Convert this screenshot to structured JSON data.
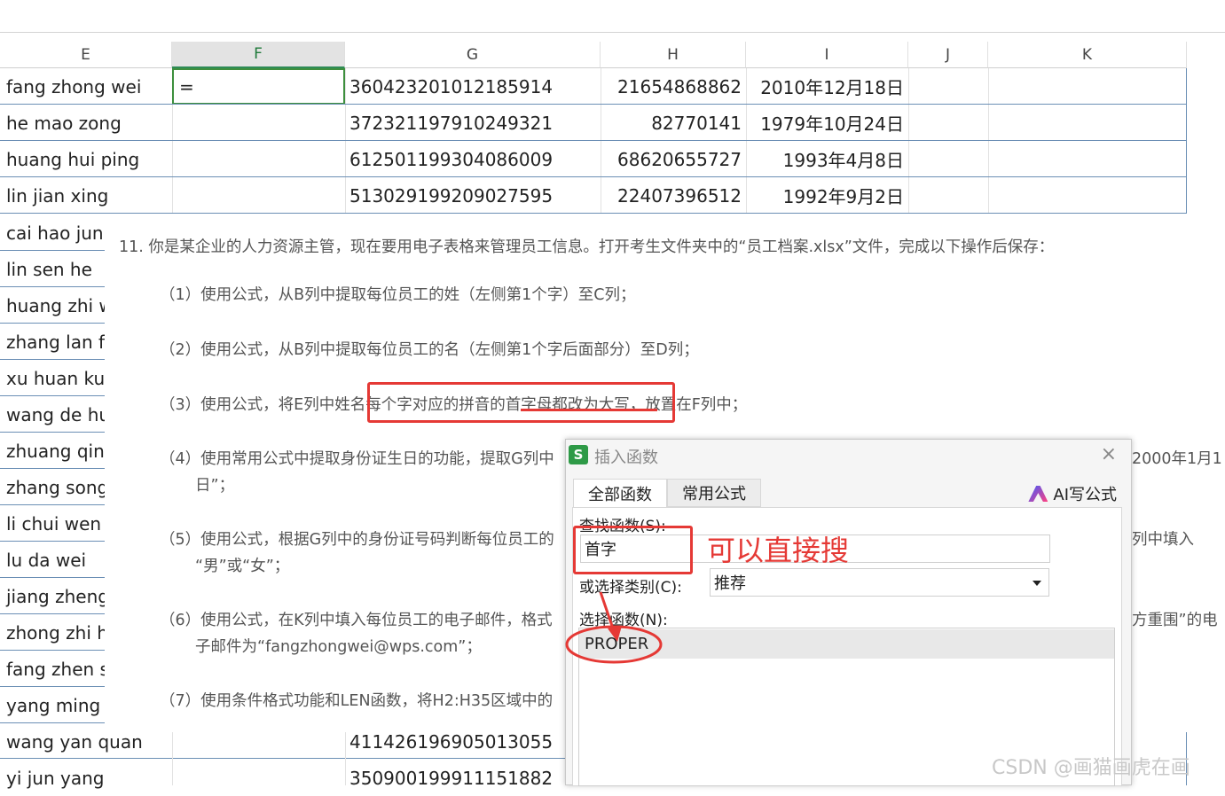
{
  "columns": [
    "E",
    "F",
    "G",
    "H",
    "I",
    "J",
    "K"
  ],
  "active_cell_value": "=",
  "rows": [
    {
      "name": "fang zhong wei",
      "id": "360423201012185914",
      "phone": "21654868862",
      "date": "2010年12月18日"
    },
    {
      "name": "he mao zong",
      "id": "372321197910249321",
      "phone": "82770141",
      "date": "1979年10月24日"
    },
    {
      "name": "huang hui ping",
      "id": "612501199304086009",
      "phone": "68620655727",
      "date": "1993年4月8日"
    },
    {
      "name": "lin jian xing",
      "id": "513029199209027595",
      "phone": "22407396512",
      "date": "1992年9月2日"
    }
  ],
  "partial_names": [
    "cai hao jun",
    "lin sen he",
    "huang zhi w",
    "zhang lan fa",
    "xu huan kur",
    "wang de hu",
    "zhuang qing",
    "zhang song",
    "li chui wen",
    "lu da wei",
    "jiang zheng",
    "zhong zhi h",
    "fang zhen sl",
    "yang ming z"
  ],
  "bottom_rows": [
    {
      "name": "wang yan quan",
      "id": "411426196905013055"
    },
    {
      "name": "yi jun yang",
      "id": "350900199911151882"
    }
  ],
  "instructions": {
    "q11": "11. 你是某企业的人力资源主管，现在要用电子表格来管理员工信息。打开考生文件夹中的“员工档案.xlsx”文件，完成以下操作后保存：",
    "s1": "（1）使用公式，从B列中提取每位员工的姓（左侧第1个字）至C列；",
    "s2": "（2）使用公式，从B列中提取每位员工的名（左侧第1个字后面部分）至D列；",
    "s3": "（3）使用公式，将E列中姓名每个字对应的拼音的首字母都改为大写，放置在F列中；",
    "s4a": "（4）使用常用公式中提取身份证生日的功能，提取G列中",
    "s4b": "2000年1月1",
    "s4c": "日”；",
    "s5a": "（5）使用公式，根据G列中的身份证号码判断每位员工的",
    "s5b": "列中填入",
    "s5c": "“男”或“女”；",
    "s6a": "（6）使用公式，在K列中填入每位员工的电子邮件，格式",
    "s6b": "方重围”的电",
    "s6c": "子邮件为“fangzhongwei@wps.com”；",
    "s7": "（7）使用条件格式功能和LEN函数，将H2:H35区域中的"
  },
  "dialog": {
    "logo": "S",
    "title": "插入函数",
    "close": "×",
    "tab_all": "全部函数",
    "tab_common": "常用公式",
    "ai_write": "AI写公式",
    "search_label": "查找函数(S):",
    "search_value": "首字",
    "category_label": "或选择类别(C):",
    "category_value": "推荐",
    "select_label": "选择函数(N):",
    "functions": [
      "PROPER"
    ]
  },
  "annotation_text": "可以直接搜",
  "watermark": "CSDN @画猫画虎在画",
  "colors": {
    "accent_red": "#e53935",
    "active_green": "#3d8f3d",
    "row_line": "#6b8fb5"
  }
}
